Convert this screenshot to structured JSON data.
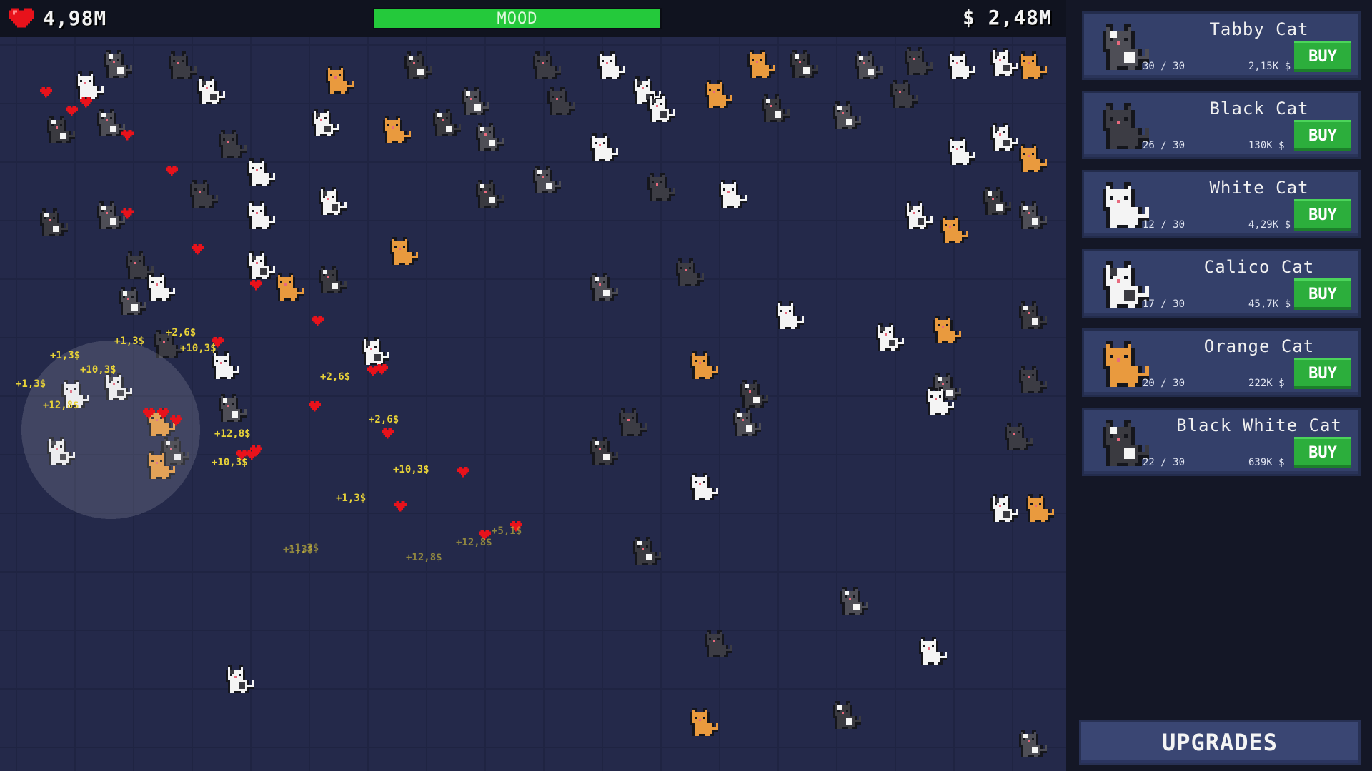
{
  "hud": {
    "hearts": "4,98M",
    "mood_label": "MOOD",
    "mood_fraction": 1.0,
    "money": "$ 2,48M",
    "heart_icon": "heart-icon",
    "colors": {
      "mood": "#24c93b",
      "heart": "#e8121b",
      "float_text": "#e8d238"
    }
  },
  "shop": {
    "items": [
      {
        "name": "Tabby Cat",
        "count": "30 / 30",
        "price": "2,15K $",
        "buy": "BUY",
        "colors": [
          "#4e4e56",
          "#f6f6f6"
        ]
      },
      {
        "name": "Black Cat",
        "count": "26 / 30",
        "price": "130K $",
        "buy": "BUY",
        "colors": [
          "#3c3c44",
          "#3c3c44"
        ]
      },
      {
        "name": "White Cat",
        "count": "12 / 30",
        "price": "4,29K $",
        "buy": "BUY",
        "colors": [
          "#f4f4f4",
          "#f4f4f4"
        ]
      },
      {
        "name": "Calico Cat",
        "count": "17 / 30",
        "price": "45,7K $",
        "buy": "BUY",
        "colors": [
          "#f4f4f4",
          "#3a3a40"
        ]
      },
      {
        "name": "Orange Cat",
        "count": "20 / 30",
        "price": "222K $",
        "buy": "BUY",
        "colors": [
          "#e99a3e",
          "#e99a3e"
        ]
      },
      {
        "name": "Black White Cat",
        "count": "22 / 30",
        "price": "639K $",
        "buy": "BUY",
        "colors": [
          "#3a3a40",
          "#f4f4f4"
        ]
      }
    ],
    "upgrades_label": "UPGRADES"
  },
  "field": {
    "floating_texts": [
      "+1,3$",
      "+2,6$",
      "+10,3$",
      "+12,8$",
      "+5,1$"
    ]
  }
}
